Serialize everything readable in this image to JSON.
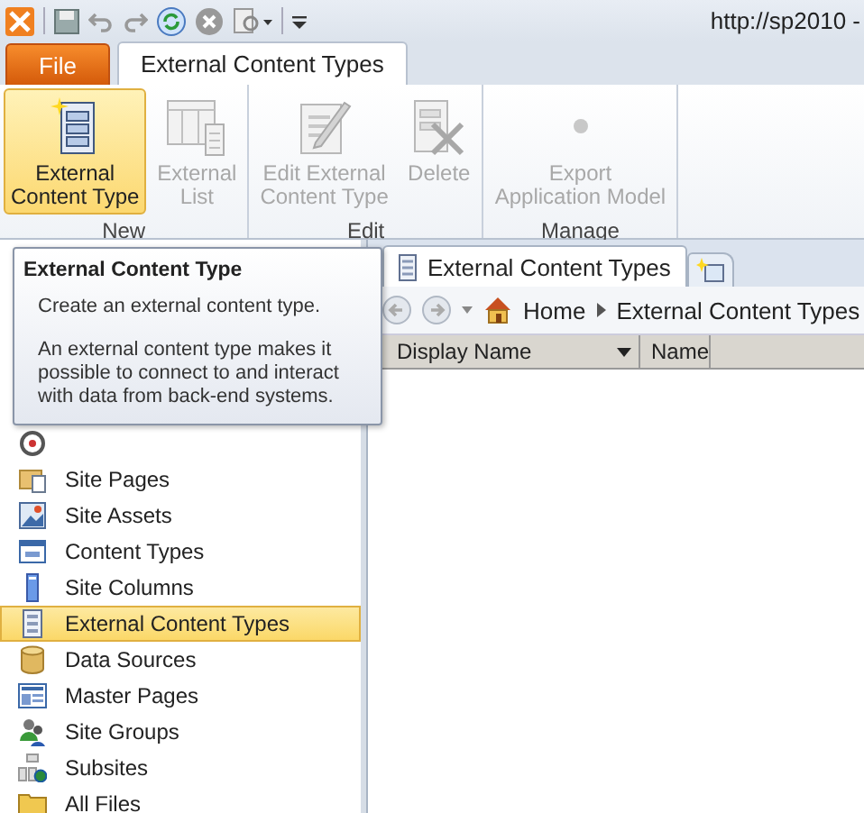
{
  "title_bar": {
    "address": "http://sp2010 -"
  },
  "ribbon_tabs": [
    {
      "label": "File",
      "kind": "file",
      "selected": false
    },
    {
      "label": "External Content Types",
      "kind": "tab",
      "selected": true
    }
  ],
  "ribbon_groups": [
    {
      "label": "New",
      "buttons": [
        {
          "label": "External\nContent Type",
          "selected": true,
          "disabled": false
        },
        {
          "label": "External\nList",
          "selected": false,
          "disabled": true
        }
      ]
    },
    {
      "label": "Edit",
      "buttons": [
        {
          "label": "Edit External\nContent Type",
          "selected": false,
          "disabled": true
        },
        {
          "label": "Delete",
          "selected": false,
          "disabled": true
        }
      ]
    },
    {
      "label": "Manage",
      "buttons": [
        {
          "label": "Export\nApplication Model",
          "selected": false,
          "disabled": true
        }
      ]
    }
  ],
  "tooltip": {
    "title": "External Content Type",
    "lines": [
      "Create an external content type.",
      "An external content type makes it\npossible to connect to and interact\nwith data from back-end systems."
    ]
  },
  "doc_tabs": [
    {
      "label": "External Content Types",
      "selected": true
    }
  ],
  "breadcrumb": [
    "Home",
    "External Content Types"
  ],
  "columns": [
    "Display Name",
    "Name"
  ],
  "sidebar": [
    {
      "selected": false
    },
    {
      "label": "Site Pages",
      "selected": false
    },
    {
      "label": "Site Assets",
      "selected": false
    },
    {
      "label": "Content Types",
      "selected": false
    },
    {
      "label": "Site Columns",
      "selected": false
    },
    {
      "label": "External Content Types",
      "selected": true
    },
    {
      "label": "Data Sources",
      "selected": false
    },
    {
      "label": "Master Pages",
      "selected": false
    },
    {
      "label": "Site Groups",
      "selected": false
    },
    {
      "label": "Subsites",
      "selected": false
    },
    {
      "label": "All Files",
      "selected": false
    }
  ]
}
